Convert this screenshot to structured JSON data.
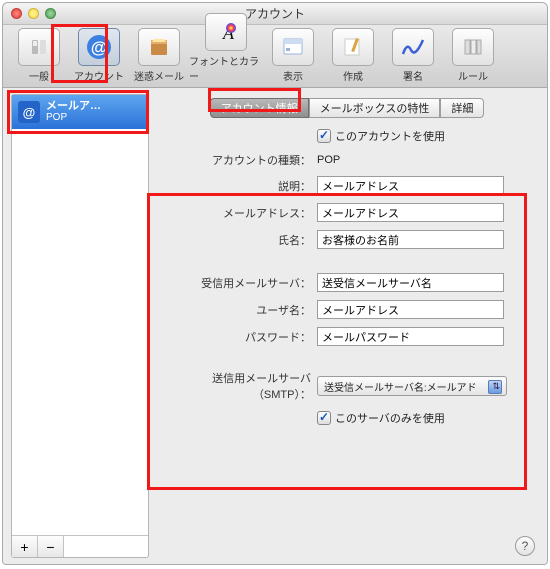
{
  "window_title": "アカウント",
  "toolbar": [
    {
      "label": "一般",
      "icon": "switch"
    },
    {
      "label": "アカウント",
      "icon": "at",
      "selected": true
    },
    {
      "label": "迷惑メール",
      "icon": "junk"
    },
    {
      "label": "フォントとカラー",
      "icon": "font"
    },
    {
      "label": "表示",
      "icon": "view"
    },
    {
      "label": "作成",
      "icon": "compose"
    },
    {
      "label": "署名",
      "icon": "signature"
    },
    {
      "label": "ルール",
      "icon": "rules"
    }
  ],
  "sidebar": {
    "account": {
      "name": "メールア…",
      "proto": "POP"
    },
    "add_label": "+",
    "remove_label": "−"
  },
  "tabs": {
    "items": [
      "アカウント情報",
      "メールボックスの特性",
      "詳細"
    ],
    "active_index": 0
  },
  "form": {
    "use_account": {
      "label": "このアカウントを使用",
      "checked": true
    },
    "type": {
      "label": "アカウントの種類：",
      "value": "POP"
    },
    "description": {
      "label": "説明：",
      "value": "メールアドレス"
    },
    "email": {
      "label": "メールアドレス：",
      "value": "メールアドレス"
    },
    "name": {
      "label": "氏名：",
      "value": "お客様のお名前"
    },
    "incoming": {
      "label": "受信用メールサーバ：",
      "value": "送受信メールサーバ名"
    },
    "user": {
      "label": "ユーザ名：",
      "value": "メールアドレス"
    },
    "password": {
      "label": "パスワード：",
      "value": "メールパスワード"
    },
    "smtp_label": "送信用メールサーバ（SMTP）：",
    "smtp_popup": "送受信メールサーバ名:メールアド",
    "only_this": {
      "label": "このサーバのみを使用",
      "checked": true
    }
  },
  "help": "?"
}
